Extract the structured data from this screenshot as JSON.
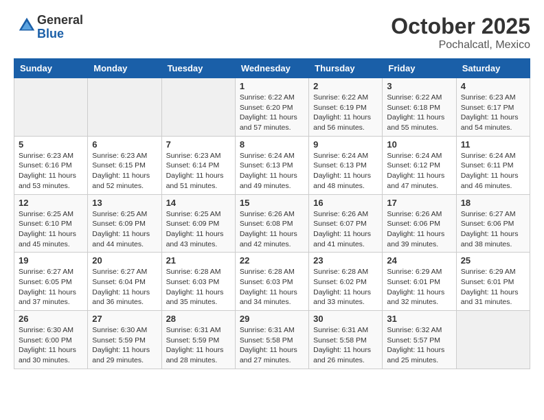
{
  "header": {
    "logo_line1": "General",
    "logo_line2": "Blue",
    "month": "October 2025",
    "location": "Pochalcatl, Mexico"
  },
  "weekdays": [
    "Sunday",
    "Monday",
    "Tuesday",
    "Wednesday",
    "Thursday",
    "Friday",
    "Saturday"
  ],
  "weeks": [
    [
      {
        "day": "",
        "info": ""
      },
      {
        "day": "",
        "info": ""
      },
      {
        "day": "",
        "info": ""
      },
      {
        "day": "1",
        "info": "Sunrise: 6:22 AM\nSunset: 6:20 PM\nDaylight: 11 hours\nand 57 minutes."
      },
      {
        "day": "2",
        "info": "Sunrise: 6:22 AM\nSunset: 6:19 PM\nDaylight: 11 hours\nand 56 minutes."
      },
      {
        "day": "3",
        "info": "Sunrise: 6:22 AM\nSunset: 6:18 PM\nDaylight: 11 hours\nand 55 minutes."
      },
      {
        "day": "4",
        "info": "Sunrise: 6:23 AM\nSunset: 6:17 PM\nDaylight: 11 hours\nand 54 minutes."
      }
    ],
    [
      {
        "day": "5",
        "info": "Sunrise: 6:23 AM\nSunset: 6:16 PM\nDaylight: 11 hours\nand 53 minutes."
      },
      {
        "day": "6",
        "info": "Sunrise: 6:23 AM\nSunset: 6:15 PM\nDaylight: 11 hours\nand 52 minutes."
      },
      {
        "day": "7",
        "info": "Sunrise: 6:23 AM\nSunset: 6:14 PM\nDaylight: 11 hours\nand 51 minutes."
      },
      {
        "day": "8",
        "info": "Sunrise: 6:24 AM\nSunset: 6:13 PM\nDaylight: 11 hours\nand 49 minutes."
      },
      {
        "day": "9",
        "info": "Sunrise: 6:24 AM\nSunset: 6:13 PM\nDaylight: 11 hours\nand 48 minutes."
      },
      {
        "day": "10",
        "info": "Sunrise: 6:24 AM\nSunset: 6:12 PM\nDaylight: 11 hours\nand 47 minutes."
      },
      {
        "day": "11",
        "info": "Sunrise: 6:24 AM\nSunset: 6:11 PM\nDaylight: 11 hours\nand 46 minutes."
      }
    ],
    [
      {
        "day": "12",
        "info": "Sunrise: 6:25 AM\nSunset: 6:10 PM\nDaylight: 11 hours\nand 45 minutes."
      },
      {
        "day": "13",
        "info": "Sunrise: 6:25 AM\nSunset: 6:09 PM\nDaylight: 11 hours\nand 44 minutes."
      },
      {
        "day": "14",
        "info": "Sunrise: 6:25 AM\nSunset: 6:09 PM\nDaylight: 11 hours\nand 43 minutes."
      },
      {
        "day": "15",
        "info": "Sunrise: 6:26 AM\nSunset: 6:08 PM\nDaylight: 11 hours\nand 42 minutes."
      },
      {
        "day": "16",
        "info": "Sunrise: 6:26 AM\nSunset: 6:07 PM\nDaylight: 11 hours\nand 41 minutes."
      },
      {
        "day": "17",
        "info": "Sunrise: 6:26 AM\nSunset: 6:06 PM\nDaylight: 11 hours\nand 39 minutes."
      },
      {
        "day": "18",
        "info": "Sunrise: 6:27 AM\nSunset: 6:06 PM\nDaylight: 11 hours\nand 38 minutes."
      }
    ],
    [
      {
        "day": "19",
        "info": "Sunrise: 6:27 AM\nSunset: 6:05 PM\nDaylight: 11 hours\nand 37 minutes."
      },
      {
        "day": "20",
        "info": "Sunrise: 6:27 AM\nSunset: 6:04 PM\nDaylight: 11 hours\nand 36 minutes."
      },
      {
        "day": "21",
        "info": "Sunrise: 6:28 AM\nSunset: 6:03 PM\nDaylight: 11 hours\nand 35 minutes."
      },
      {
        "day": "22",
        "info": "Sunrise: 6:28 AM\nSunset: 6:03 PM\nDaylight: 11 hours\nand 34 minutes."
      },
      {
        "day": "23",
        "info": "Sunrise: 6:28 AM\nSunset: 6:02 PM\nDaylight: 11 hours\nand 33 minutes."
      },
      {
        "day": "24",
        "info": "Sunrise: 6:29 AM\nSunset: 6:01 PM\nDaylight: 11 hours\nand 32 minutes."
      },
      {
        "day": "25",
        "info": "Sunrise: 6:29 AM\nSunset: 6:01 PM\nDaylight: 11 hours\nand 31 minutes."
      }
    ],
    [
      {
        "day": "26",
        "info": "Sunrise: 6:30 AM\nSunset: 6:00 PM\nDaylight: 11 hours\nand 30 minutes."
      },
      {
        "day": "27",
        "info": "Sunrise: 6:30 AM\nSunset: 5:59 PM\nDaylight: 11 hours\nand 29 minutes."
      },
      {
        "day": "28",
        "info": "Sunrise: 6:31 AM\nSunset: 5:59 PM\nDaylight: 11 hours\nand 28 minutes."
      },
      {
        "day": "29",
        "info": "Sunrise: 6:31 AM\nSunset: 5:58 PM\nDaylight: 11 hours\nand 27 minutes."
      },
      {
        "day": "30",
        "info": "Sunrise: 6:31 AM\nSunset: 5:58 PM\nDaylight: 11 hours\nand 26 minutes."
      },
      {
        "day": "31",
        "info": "Sunrise: 6:32 AM\nSunset: 5:57 PM\nDaylight: 11 hours\nand 25 minutes."
      },
      {
        "day": "",
        "info": ""
      }
    ]
  ]
}
